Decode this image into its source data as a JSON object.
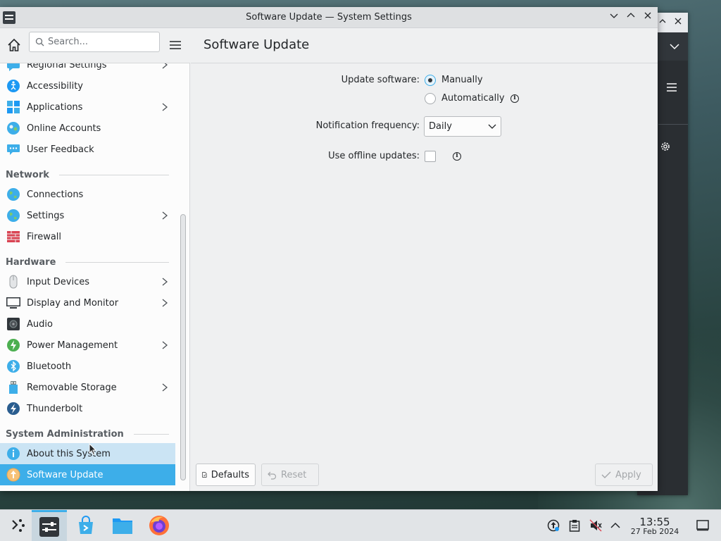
{
  "window": {
    "title": "Software Update — System Settings",
    "controls": [
      "minimize",
      "maximize",
      "close"
    ]
  },
  "sidebar": {
    "search_placeholder": "Search...",
    "items": [
      {
        "label": "Regional Settings",
        "icon": "regional-settings-icon",
        "chevron": true
      },
      {
        "label": "Accessibility",
        "icon": "accessibility-icon",
        "chevron": false
      },
      {
        "label": "Applications",
        "icon": "applications-icon",
        "chevron": true
      },
      {
        "label": "Online Accounts",
        "icon": "online-accounts-icon",
        "chevron": false
      },
      {
        "label": "User Feedback",
        "icon": "user-feedback-icon",
        "chevron": false
      }
    ],
    "categories": {
      "network": {
        "title": "Network",
        "items": [
          {
            "label": "Connections",
            "icon": "globe-icon",
            "chevron": false
          },
          {
            "label": "Settings",
            "icon": "globe-icon",
            "chevron": true
          },
          {
            "label": "Firewall",
            "icon": "firewall-icon",
            "chevron": false
          }
        ]
      },
      "hardware": {
        "title": "Hardware",
        "items": [
          {
            "label": "Input Devices",
            "icon": "mouse-icon",
            "chevron": true
          },
          {
            "label": "Display and Monitor",
            "icon": "monitor-icon",
            "chevron": true
          },
          {
            "label": "Audio",
            "icon": "speaker-icon",
            "chevron": false
          },
          {
            "label": "Power Management",
            "icon": "power-icon",
            "chevron": true
          },
          {
            "label": "Bluetooth",
            "icon": "bluetooth-icon",
            "chevron": false
          },
          {
            "label": "Removable Storage",
            "icon": "usb-drive-icon",
            "chevron": true
          },
          {
            "label": "Thunderbolt",
            "icon": "thunderbolt-icon",
            "chevron": false
          }
        ]
      },
      "sysadmin": {
        "title": "System Administration",
        "items": [
          {
            "label": "About this System",
            "icon": "info-icon",
            "chevron": false,
            "state": "hover"
          },
          {
            "label": "Software Update",
            "icon": "software-update-icon",
            "chevron": false,
            "state": "selected"
          }
        ]
      }
    }
  },
  "content": {
    "title": "Software Update",
    "update_software": {
      "label": "Update software:",
      "options": [
        "Manually",
        "Automatically"
      ],
      "selected": "Manually"
    },
    "notification_frequency": {
      "label": "Notification frequency:",
      "value": "Daily"
    },
    "offline_updates": {
      "label": "Use offline updates:",
      "checked": false
    },
    "footer": {
      "defaults": "Defaults",
      "reset": "Reset",
      "apply": "Apply"
    }
  },
  "taskbar": {
    "apps": [
      "application-launcher",
      "system-settings",
      "discover",
      "dolphin-file-manager",
      "firefox"
    ],
    "active_app": "system-settings",
    "tray": [
      "update-notifier-icon",
      "clipboard-icon",
      "volume-muted-icon",
      "tray-expand-icon"
    ],
    "clock": {
      "time": "13:55",
      "date": "27 Feb 2024"
    }
  },
  "colors": {
    "accent": "#3daee9",
    "hover": "#cbe4f4",
    "window_bg": "#eff0f1",
    "sidebar_bg": "#fcfcfc"
  }
}
